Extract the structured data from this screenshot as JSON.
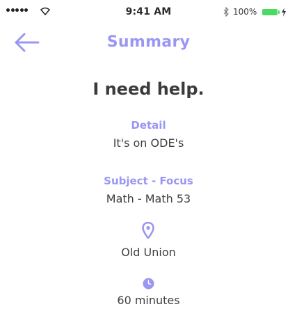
{
  "status_bar": {
    "time": "9:41 AM",
    "battery_percent": "100%",
    "battery_color": "#4cd964"
  },
  "nav": {
    "back_icon": "arrow-left-icon",
    "title": "Summary"
  },
  "request": {
    "headline": "I need help.",
    "detail_label": "Detail",
    "detail_value": "It's on ODE's",
    "subject_label": "Subject - Focus",
    "subject_value": "Math - Math 53",
    "location_icon": "map-pin-icon",
    "location": "Old Union",
    "duration_icon": "clock-icon",
    "duration": "60 minutes"
  },
  "colors": {
    "accent": "#9a97f4",
    "text": "#3b3b3b"
  }
}
